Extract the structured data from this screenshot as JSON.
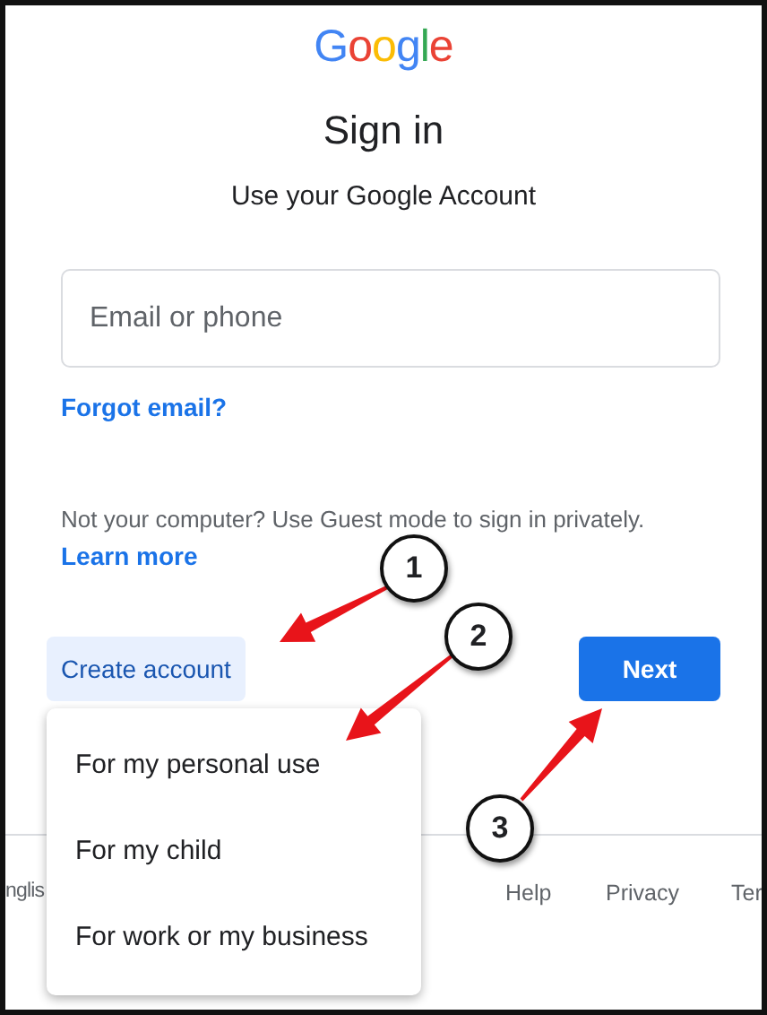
{
  "logo": "Google",
  "title": "Sign in",
  "subtitle": "Use your Google Account",
  "email_field": {
    "placeholder": "Email or phone"
  },
  "forgot_link": "Forgot email?",
  "guest_notice": "Not your computer? Use Guest mode to sign in privately.",
  "learn_more_link": "Learn more",
  "create_account_button": "Create account",
  "next_button": "Next",
  "create_account_menu": [
    {
      "label": "For my personal use"
    },
    {
      "label": "For my child"
    },
    {
      "label": "For work or my business"
    }
  ],
  "footer": {
    "language": "nglis",
    "links": [
      "Help",
      "Privacy",
      "Ter"
    ]
  },
  "annotations": [
    {
      "label": "1"
    },
    {
      "label": "2"
    },
    {
      "label": "3"
    }
  ]
}
